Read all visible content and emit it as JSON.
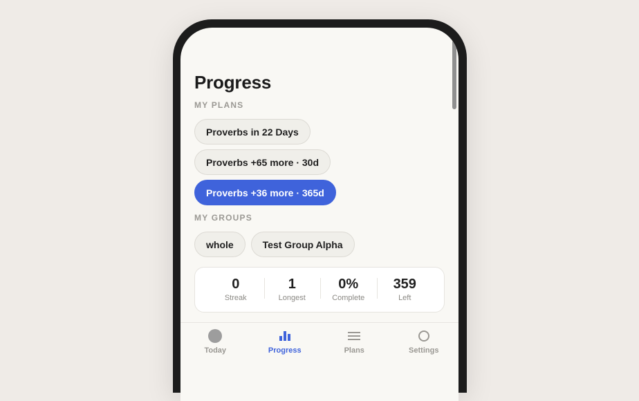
{
  "page": {
    "title": "Progress"
  },
  "plans": {
    "label": "MY PLANS",
    "items": [
      {
        "label": "Proverbs in 22 Days",
        "selected": false
      },
      {
        "label": "Proverbs +65 more · 30d",
        "selected": false
      },
      {
        "label": "Proverbs +36 more · 365d",
        "selected": true
      }
    ]
  },
  "groups": {
    "label": "MY GROUPS",
    "items": [
      {
        "label": "whole"
      },
      {
        "label": "Test Group Alpha"
      }
    ]
  },
  "stats": [
    {
      "value": "0",
      "label": "Streak"
    },
    {
      "value": "1",
      "label": "Longest"
    },
    {
      "value": "0%",
      "label": "Complete"
    },
    {
      "value": "359",
      "label": "Left"
    }
  ],
  "tabs": [
    {
      "label": "Today",
      "icon": "circle-icon",
      "active": false
    },
    {
      "label": "Progress",
      "icon": "bar-chart-icon",
      "active": true
    },
    {
      "label": "Plans",
      "icon": "list-icon",
      "active": false
    },
    {
      "label": "Settings",
      "icon": "ring-icon",
      "active": false
    }
  ],
  "colors": {
    "accent": "#3f63db",
    "background": "#f9f8f4",
    "page": "#efebe7"
  }
}
